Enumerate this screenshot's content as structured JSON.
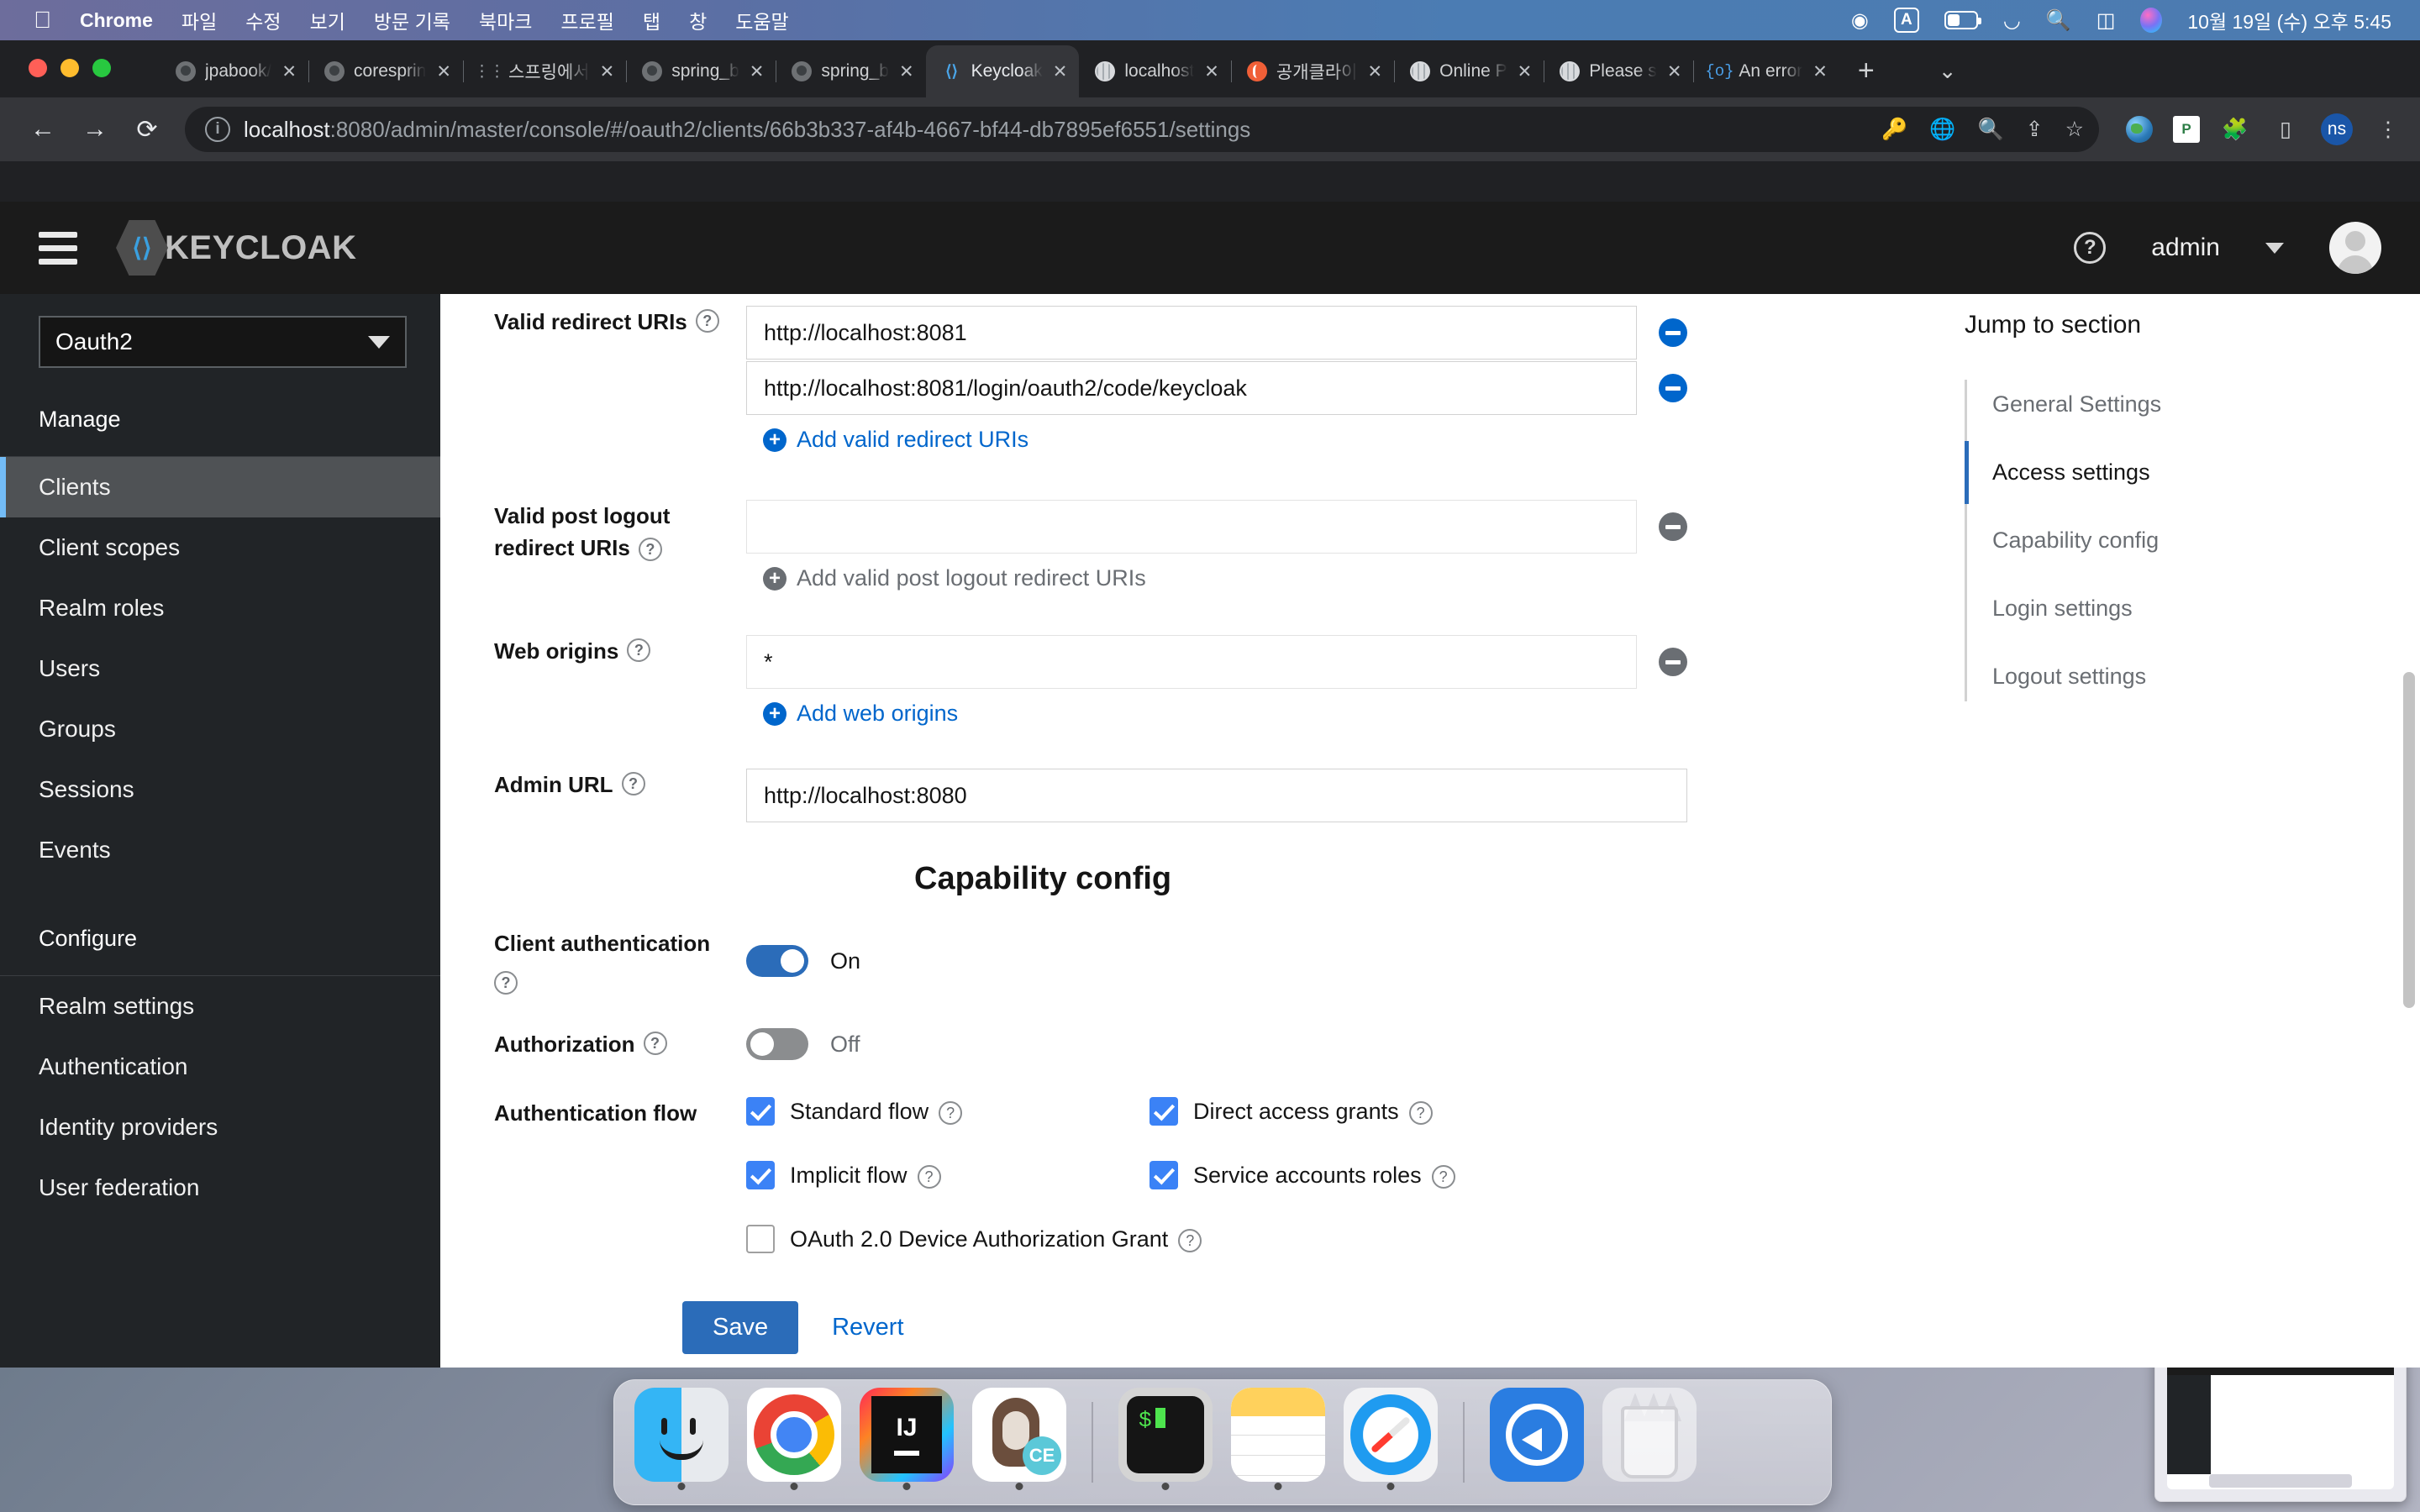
{
  "macbar": {
    "apple_icon": "apple-icon",
    "app_name": "Chrome",
    "menus": [
      "파일",
      "수정",
      "보기",
      "방문 기록",
      "북마크",
      "프로필",
      "탭",
      "창",
      "도움말"
    ],
    "status_icons": [
      "vpn-icon",
      "input-source-icon",
      "battery-icon",
      "wifi-icon",
      "search-icon",
      "control-center-icon",
      "siri-icon"
    ],
    "input_source_letter": "A",
    "clock": "10월 19일 (수) 오후 5:45"
  },
  "browser": {
    "tabs": [
      {
        "label": "jpabook/",
        "favicon": "github-icon",
        "active": false
      },
      {
        "label": "coresprin",
        "favicon": "github-icon",
        "active": false
      },
      {
        "label": "스프링에서",
        "favicon": "dots-icon",
        "active": false
      },
      {
        "label": "spring_b",
        "favicon": "github-icon",
        "active": false
      },
      {
        "label": "spring_b",
        "favicon": "github-icon",
        "active": false
      },
      {
        "label": "Keycloak",
        "favicon": "keycloak-icon",
        "active": true
      },
      {
        "label": "localhost",
        "favicon": "globe-icon",
        "active": false
      },
      {
        "label": "공개클라이",
        "favicon": "orange-icon",
        "active": false
      },
      {
        "label": "Online P",
        "favicon": "globe-icon",
        "active": false
      },
      {
        "label": "Please s",
        "favicon": "globe-icon",
        "active": false
      },
      {
        "label": "An error",
        "favicon": "brace-icon",
        "active": false
      }
    ],
    "new_tab_label": "+",
    "tab_list_chevron": "⌄",
    "nav": {
      "back": "←",
      "forward": "→",
      "reload": "⟳"
    },
    "url_host": "localhost",
    "url_rest": ":8080/admin/master/console/#/oauth2/clients/66b3b337-af4b-4667-bf44-db7895ef6551/settings",
    "omnibox_icons": [
      "password-key-icon",
      "translate-icon",
      "zoom-out-icon",
      "share-icon",
      "bookmark-star-icon"
    ],
    "extension_icons": [
      "earth-extension-icon",
      "paper-extension-icon",
      "puzzle-extensions-icon",
      "sidepanel-icon",
      "profile-ns-icon",
      "chrome-menu-icon"
    ],
    "profile_initials": "ns"
  },
  "keycloak": {
    "header": {
      "menu_icon": "hamburger-icon",
      "logo_text": "KEYCLOAK",
      "help_icon": "help-circle-icon",
      "user_name": "admin",
      "avatar_icon": "user-avatar-icon"
    },
    "sidebar": {
      "realm_selected": "Oauth2",
      "groups": [
        {
          "title": "Manage",
          "items": [
            {
              "label": "Clients",
              "active": true
            },
            {
              "label": "Client scopes",
              "active": false
            },
            {
              "label": "Realm roles",
              "active": false
            },
            {
              "label": "Users",
              "active": false
            },
            {
              "label": "Groups",
              "active": false
            },
            {
              "label": "Sessions",
              "active": false
            },
            {
              "label": "Events",
              "active": false
            }
          ]
        },
        {
          "title": "Configure",
          "items": [
            {
              "label": "Realm settings",
              "active": false
            },
            {
              "label": "Authentication",
              "active": false
            },
            {
              "label": "Identity providers",
              "active": false
            },
            {
              "label": "User federation",
              "active": false
            }
          ]
        }
      ]
    },
    "form": {
      "valid_redirect_uris": {
        "label": "Valid redirect URIs",
        "values": [
          "http://localhost:8081",
          "http://localhost:8081/login/oauth2/code/keycloak"
        ],
        "add_label": "Add valid redirect URIs"
      },
      "valid_post_logout_redirect_uris": {
        "label_line1": "Valid post logout",
        "label_line2": "redirect URIs",
        "values": [
          ""
        ],
        "add_label": "Add valid post logout redirect URIs"
      },
      "web_origins": {
        "label": "Web origins",
        "values": [
          "*"
        ],
        "add_label": "Add web origins"
      },
      "admin_url": {
        "label": "Admin URL",
        "value": "http://localhost:8080"
      },
      "capability_config": {
        "heading": "Capability config",
        "client_authentication": {
          "label": "Client authentication",
          "state": "On",
          "on": true
        },
        "authorization": {
          "label": "Authorization",
          "state": "Off",
          "on": false
        },
        "authentication_flow": {
          "label": "Authentication flow",
          "options": [
            {
              "label": "Standard flow",
              "checked": true
            },
            {
              "label": "Direct access grants",
              "checked": true
            },
            {
              "label": "Implicit flow",
              "checked": true
            },
            {
              "label": "Service accounts roles",
              "checked": true
            },
            {
              "label": "OAuth 2.0 Device Authorization Grant",
              "checked": false
            }
          ]
        }
      }
    },
    "jump_to_section": {
      "title": "Jump to section",
      "items": [
        {
          "label": "General Settings",
          "active": false
        },
        {
          "label": "Access settings",
          "active": true
        },
        {
          "label": "Capability config",
          "active": false
        },
        {
          "label": "Login settings",
          "active": false
        },
        {
          "label": "Logout settings",
          "active": false
        }
      ]
    },
    "actions": {
      "save_label": "Save",
      "revert_label": "Revert"
    }
  },
  "dock": {
    "items": [
      {
        "name": "finder-icon"
      },
      {
        "name": "chrome-icon"
      },
      {
        "name": "intellij-idea-icon"
      },
      {
        "name": "ce-otter-icon"
      },
      {
        "name": "terminal-icon"
      },
      {
        "name": "notes-icon"
      },
      {
        "name": "safari-icon"
      },
      {
        "name": "system-preferences-icon"
      },
      {
        "name": "trash-icon"
      }
    ]
  },
  "colors": {
    "accent_blue": "#0066cc",
    "toggle_on": "#2b6cb9",
    "checkbox_blue": "#3b82f6",
    "sidebar_bg": "#212427",
    "keycloak_header_bg": "#1b1b1b",
    "active_nav_marker": "#73bcf7"
  }
}
